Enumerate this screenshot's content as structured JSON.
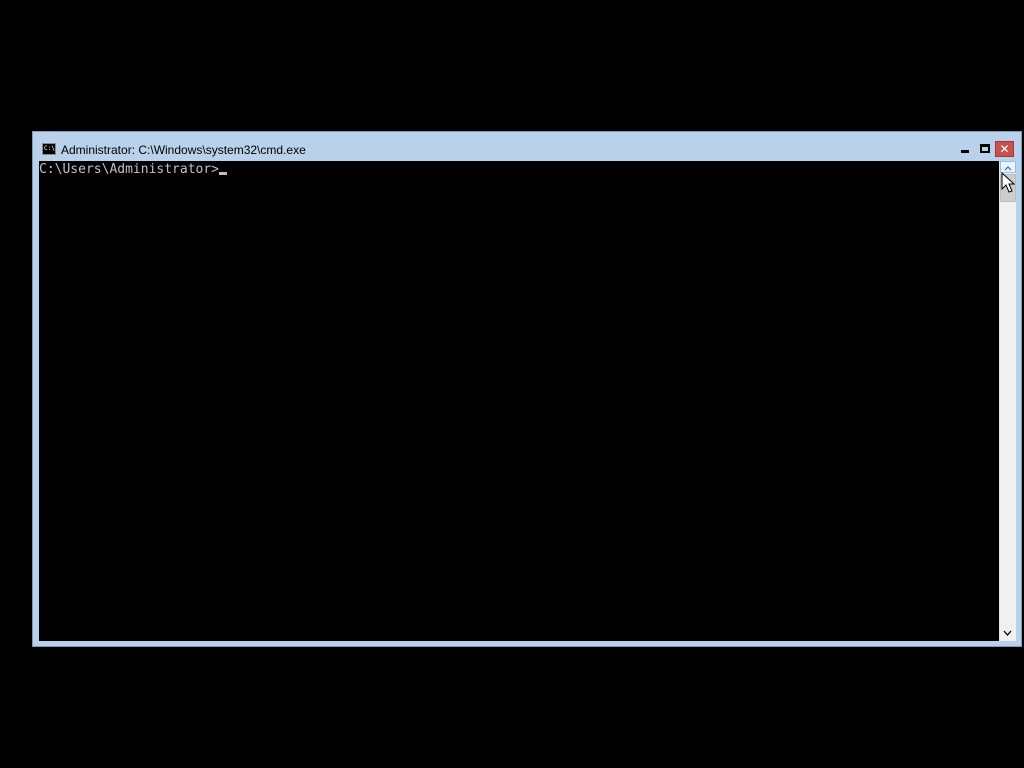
{
  "window": {
    "title": "Administrator: C:\\Windows\\system32\\cmd.exe",
    "icon": "cmd-console-icon",
    "icon_text": "C:\\",
    "controls": {
      "minimize": "minimize-icon",
      "maximize": "maximize-icon",
      "close": "close-icon",
      "close_glyph": "✕"
    }
  },
  "console": {
    "prompt": "C:\\Users\\Administrator>",
    "text_color": "#c0c0c0",
    "background": "#000000"
  },
  "scrollbar": {
    "up_icon": "scroll-up-arrow-icon",
    "down_icon": "scroll-down-arrow-icon"
  },
  "colors": {
    "titlebar": "#b9d1ea",
    "close_button": "#c75050"
  }
}
